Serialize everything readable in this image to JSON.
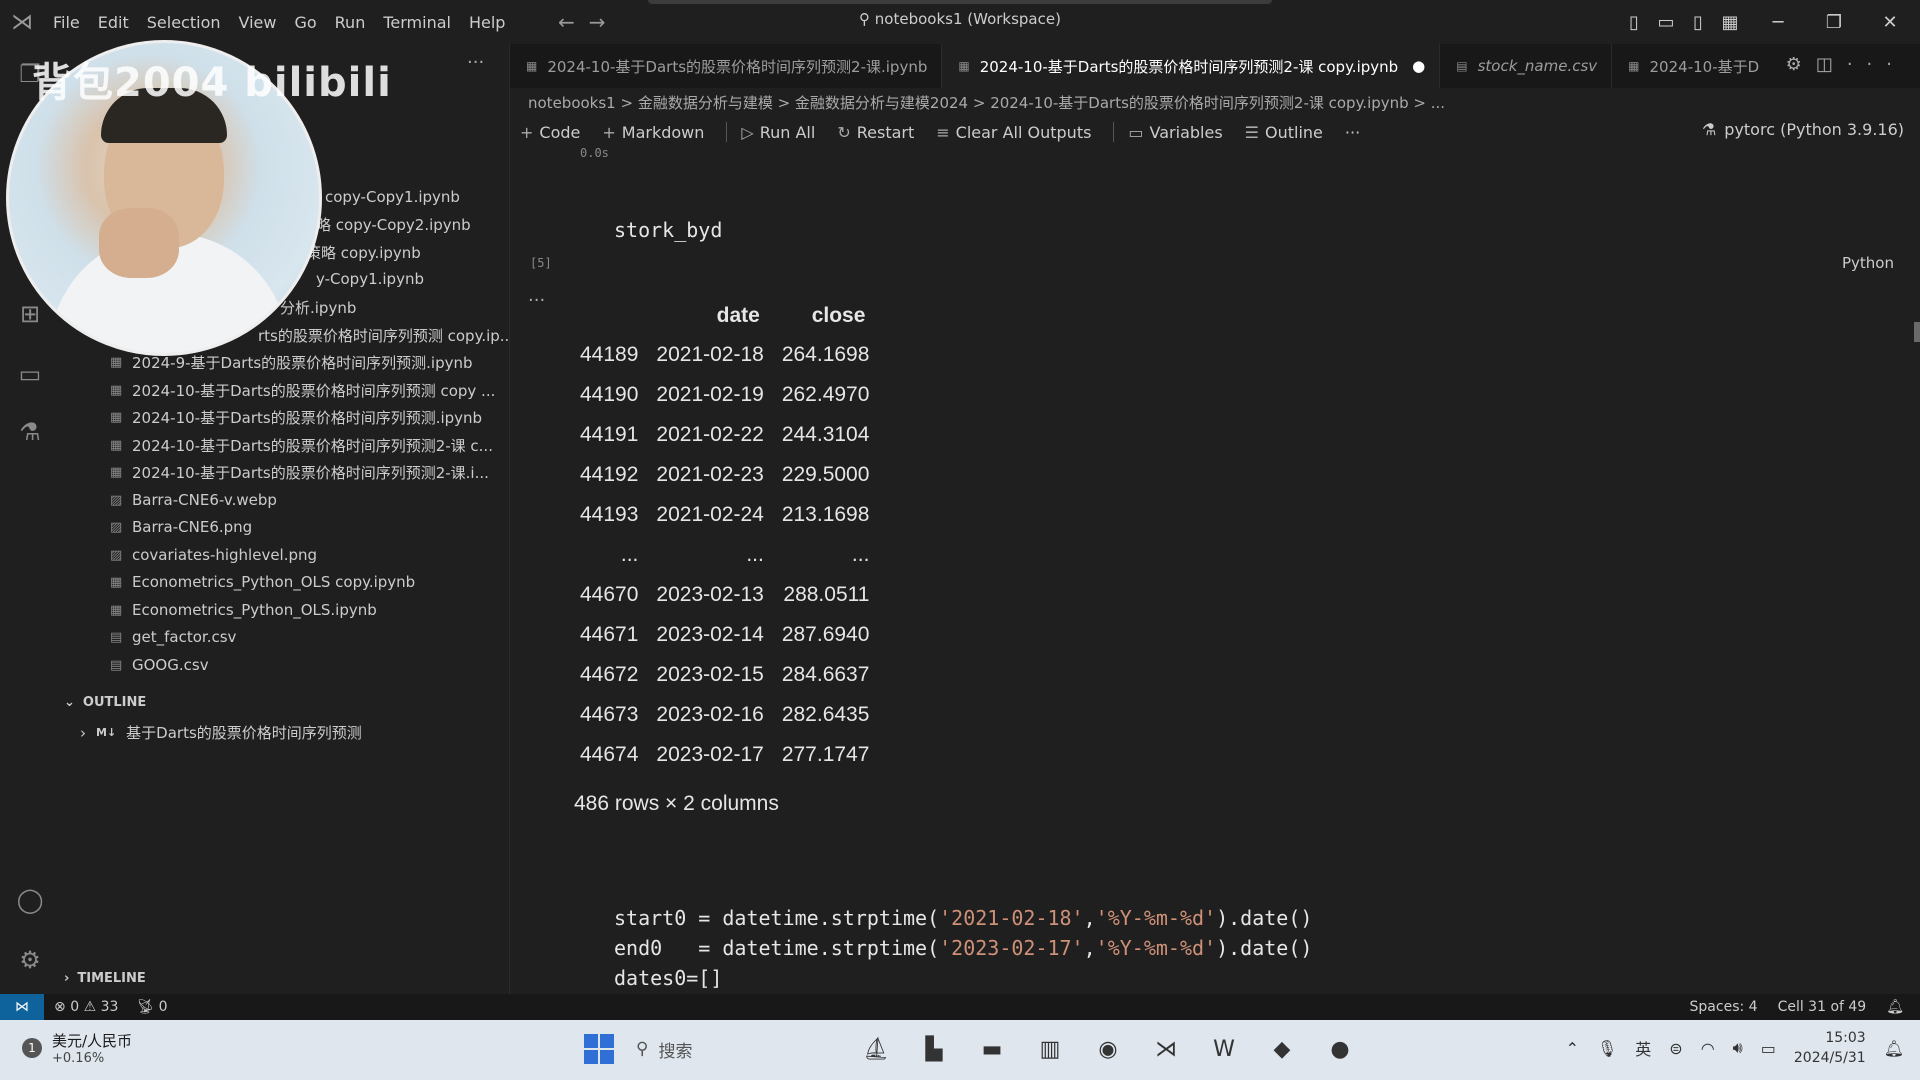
{
  "titlebar": {
    "menu": [
      "File",
      "Edit",
      "Selection",
      "View",
      "Go",
      "Run",
      "Terminal",
      "Help"
    ],
    "command_center": "notebooks1 (Workspace)"
  },
  "webcam": {
    "watermark": "背包2004 bilibili"
  },
  "explorer": {
    "files": [
      "copy-Copy1.ipynb",
      "略 copy-Copy2.ipynb",
      "策略 copy.ipynb",
      "y-Copy1.ipynb",
      "分析.ipynb",
      "rts的股票价格时间序列预测 copy.ip...",
      "2024-9-基于Darts的股票价格时间序列预测.ipynb",
      "2024-10-基于Darts的股票价格时间序列预测 copy ...",
      "2024-10-基于Darts的股票价格时间序列预测.ipynb",
      "2024-10-基于Darts的股票价格时间序列预测2-课 c...",
      "2024-10-基于Darts的股票价格时间序列预测2-课.i...",
      "Barra-CNE6-v.webp",
      "Barra-CNE6.png",
      "covariates-highlevel.png",
      "Econometrics_Python_OLS copy.ipynb",
      "Econometrics_Python_OLS.ipynb",
      "get_factor.csv",
      "GOOG.csv"
    ],
    "outline_title": "OUTLINE",
    "outline_item": "基于Darts的股票价格时间序列预测",
    "outline_prefix": "M↓",
    "timeline_title": "TIMELINE"
  },
  "tabs": [
    {
      "label": "2024-10-基于Darts的股票价格时间序列预测2-课.ipynb",
      "active": false
    },
    {
      "label": "2024-10-基于Darts的股票价格时间序列预测2-课 copy.ipynb",
      "active": true
    },
    {
      "label": "stock_name.csv",
      "active": false
    },
    {
      "label": "2024-10-基于D",
      "active": false
    }
  ],
  "breadcrumb": "notebooks1 > 金融数据分析与建模 > 金融数据分析与建模2024 > 2024-10-基于Darts的股票价格时间序列预测2-课 copy.ipynb > ...",
  "toolbar": {
    "code": "Code",
    "markdown": "Markdown",
    "run_all": "Run All",
    "restart": "Restart",
    "clear": "Clear All Outputs",
    "variables": "Variables",
    "outline": "Outline",
    "more": "···",
    "kernel": "pytorc (Python 3.9.16)"
  },
  "cell": {
    "prev_time": "0.0s",
    "exec_count": "[5]",
    "code": "stork_byd",
    "language": "Python"
  },
  "dataframe": {
    "columns": [
      "",
      "date",
      "close"
    ],
    "rows": [
      [
        "44189",
        "2021-02-18",
        "264.1698"
      ],
      [
        "44190",
        "2021-02-19",
        "262.4970"
      ],
      [
        "44191",
        "2021-02-22",
        "244.3104"
      ],
      [
        "44192",
        "2021-02-23",
        "229.5000"
      ],
      [
        "44193",
        "2021-02-24",
        "213.1698"
      ],
      [
        "...",
        "...",
        "..."
      ],
      [
        "44670",
        "2023-02-13",
        "288.0511"
      ],
      [
        "44671",
        "2023-02-14",
        "287.6940"
      ],
      [
        "44672",
        "2023-02-15",
        "284.6637"
      ],
      [
        "44673",
        "2023-02-16",
        "282.6435"
      ],
      [
        "44674",
        "2023-02-17",
        "277.1747"
      ]
    ],
    "shape": "486 rows × 2 columns"
  },
  "next_cell": {
    "line1_a": "start0 = datetime.strptime(",
    "line1_s1": "'2021-02-18'",
    "line1_b": ",",
    "line1_s2": "'%Y-%m-%d'",
    "line1_c": ").date()",
    "line2_a": "end0   = datetime.strptime(",
    "line2_s1": "'2023-02-17'",
    "line2_b": ",",
    "line2_s2": "'%Y-%m-%d'",
    "line2_c": ").date()",
    "line3": "dates0=[]"
  },
  "statusbar": {
    "errors": "0",
    "warnings": "33",
    "ports": "0",
    "spaces": "Spaces: 4",
    "cell": "Cell 31 of 49"
  },
  "taskbar": {
    "weather_title": "美元/人民币",
    "weather_value": "+0.16%",
    "badge": "1",
    "search": "搜索",
    "time": "15:03",
    "date": "2024/5/31"
  }
}
